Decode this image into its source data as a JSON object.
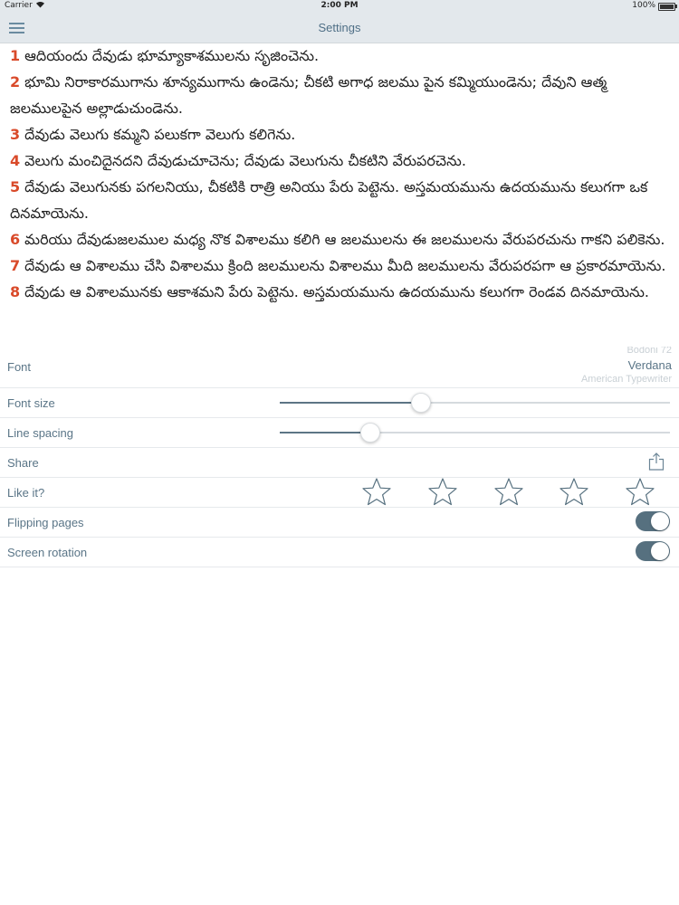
{
  "status_bar": {
    "carrier": "Carrier",
    "time": "2:00 PM",
    "battery": "100%"
  },
  "nav": {
    "title": "Settings",
    "menu_icon": "hamburger-icon"
  },
  "verses": [
    {
      "num": "1",
      "text": "ఆదియందు దేవుడు భూమ్యాకాశములను సృజించెను."
    },
    {
      "num": "2",
      "text": "భూమి నిరాకారముగాను శూన్యముగాను ఉండెను; చీకటి అగాధ జలము పైన కమ్మియుండెను; దేవుని ఆత్మ జలములపైన అల్లాడుచుండెను."
    },
    {
      "num": "3",
      "text": "దేవుడు వెలుగు కమ్మని పలుకగా వెలుగు కలిగెను."
    },
    {
      "num": "4",
      "text": "వెలుగు మంచిదైనదని దేవుడుచూచెను; దేవుడు వెలుగును చీకటిని వేరుపరచెను."
    },
    {
      "num": "5",
      "text": "దేవుడు వెలుగునకు పగలనియు, చీకటికి రాత్రి అనియు పేరు పెట్టెను. అస్తమయమును ఉదయమును కలుగగా ఒక దినమాయెను."
    },
    {
      "num": "6",
      "text": "మరియు దేవుడుజలముల మధ్య నొక విశాలము కలిగి ఆ జలములను ఈ జలములను వేరుపరచును గాకని పలికెను."
    },
    {
      "num": "7",
      "text": "దేవుడు ఆ విశాలము చేసి విశాలము క్రింది జలములను విశాలము మీది జలములను వేరుపరపగా ఆ ప్రకారమాయెను."
    },
    {
      "num": "8",
      "text": "దేవుడు ఆ విశాలమునకు ఆకాశమని పేరు పెట్టెను. అస్తమయమును ఉదయమును కలుగగా రెండవ దినమాయెను."
    }
  ],
  "settings": {
    "font": {
      "label": "Font",
      "options_above": "Bodoni 72",
      "selected": "Verdana",
      "options_below": "American Typewriter"
    },
    "font_size": {
      "label": "Font size",
      "value": 0.36
    },
    "line_spacing": {
      "label": "Line spacing",
      "value": 0.23
    },
    "share": {
      "label": "Share",
      "icon": "share-icon"
    },
    "like": {
      "label": "Like it?",
      "stars": 5,
      "rating": 0,
      "icon": "star-icon"
    },
    "flipping_pages": {
      "label": "Flipping pages",
      "on": true
    },
    "screen_rotation": {
      "label": "Screen rotation",
      "on": true
    }
  },
  "colors": {
    "verse_number": "#d94a2a",
    "accent": "#56707f",
    "label_text": "#5a7587"
  }
}
